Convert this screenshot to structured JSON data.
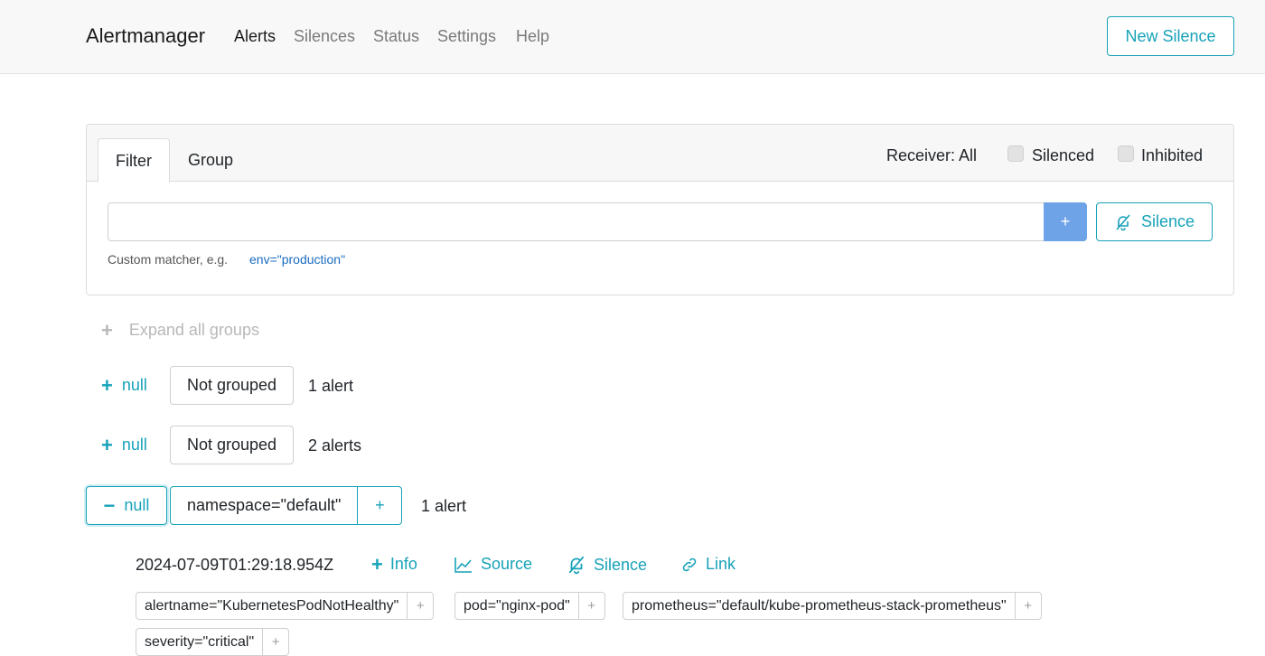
{
  "navbar": {
    "brand": "Alertmanager",
    "links": [
      "Alerts",
      "Silences",
      "Status",
      "Settings",
      "Help"
    ],
    "new_silence": "New Silence"
  },
  "filter_card": {
    "tabs": [
      "Filter",
      "Group"
    ],
    "receiver": "Receiver: All",
    "silenced_label": "Silenced",
    "inhibited_label": "Inhibited",
    "input_value": "",
    "add_button": "+",
    "silence_button": "Silence",
    "hint_text": "Custom matcher, e.g.",
    "hint_example": "env=\"production\""
  },
  "expand_all": "Expand all groups",
  "groups": [
    {
      "toggle": "null",
      "label": "Not grouped",
      "count": "1 alert"
    },
    {
      "toggle": "null",
      "label": "Not grouped",
      "count": "2 alerts"
    },
    {
      "toggle": "null",
      "label": "namespace=\"default\"",
      "add": "+",
      "count": "1 alert"
    }
  ],
  "alert": {
    "timestamp": "2024-07-09T01:29:18.954Z",
    "actions": [
      "Info",
      "Source",
      "Silence",
      "Link"
    ],
    "labels": [
      "alertname=\"KubernetesPodNotHealthy\"",
      "pod=\"nginx-pod\"",
      "prometheus=\"default/kube-prometheus-stack-prometheus\"",
      "severity=\"critical\""
    ],
    "label_add": "+"
  },
  "colors": {
    "accent": "#17a2b8",
    "primary_button": "#6ea3e8",
    "link": "#1a6cc0"
  },
  "icons": [
    "bell-slash-icon",
    "plus-icon",
    "minus-icon",
    "chart-line-icon",
    "link-icon"
  ]
}
